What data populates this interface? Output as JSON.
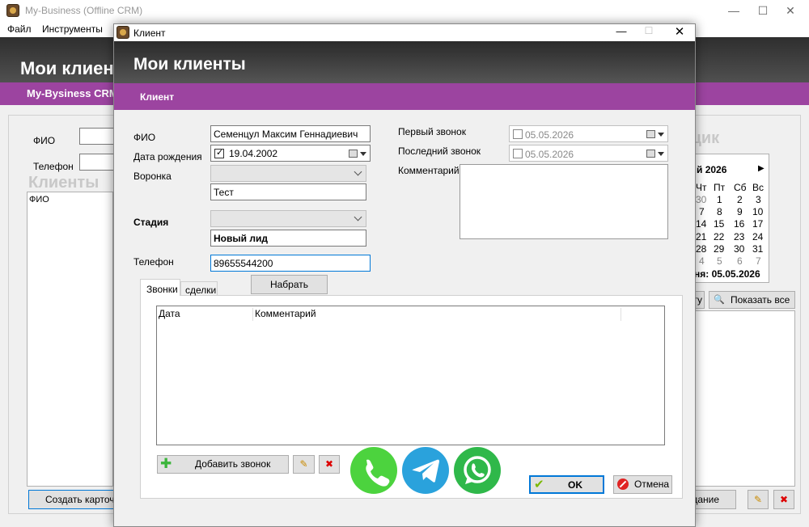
{
  "main_window": {
    "title": "My-Business (Offline CRM)",
    "menu": [
      "Файл",
      "Инструменты"
    ],
    "header_title": "Мои клиенты",
    "subtitle": "My-Bysiness CRM",
    "search": {
      "fio_label": "ФИО",
      "phone_label": "Телефон"
    },
    "clients_heading": "Клиенты",
    "clients_list_header": "ФИО",
    "scheduler_heading": "щик",
    "calendar": {
      "month": "й 2026",
      "day_headers": [
        "Чт",
        "Пт",
        "Сб",
        "Вс"
      ],
      "rows": [
        [
          "30",
          "1",
          "2",
          "3"
        ],
        [
          "7",
          "8",
          "9",
          "10"
        ],
        [
          "14",
          "15",
          "16",
          "17"
        ],
        [
          "21",
          "22",
          "23",
          "24"
        ],
        [
          "28",
          "29",
          "30",
          "31"
        ],
        [
          "4",
          "5",
          "6",
          "7"
        ]
      ],
      "today": "ня: 05.05.2026"
    },
    "buttons": {
      "left_partial": "гу",
      "show_all": "Показать все",
      "create_card": "Создать карточ",
      "bottom_right_partial": "дание"
    }
  },
  "dialog": {
    "title": "Клиент",
    "header_title": "Мои клиенты",
    "subtitle": "Клиент",
    "fio_label": "ФИО",
    "fio_value": "Семенцул Максим Геннадиевич",
    "birth_label": "Дата рождения",
    "birth_value": "19.04.2002",
    "funnel_label": "Воронка",
    "funnel_value": "Тест",
    "stage_label": "Стадия",
    "stage_value": "Новый лид",
    "phone_label": "Телефон",
    "phone_value": "89655544200",
    "dial_button": "Набрать",
    "first_call_label": "Первый звонок",
    "first_call_value": "05.05.2026",
    "last_call_label": "Последний звонок",
    "last_call_value": "05.05.2026",
    "comment_label": "Комментарий",
    "tabs": [
      "Звонки",
      "сделки"
    ],
    "grid_columns": [
      "Дата",
      "Комментарий"
    ],
    "add_call_button": "Добавить звонок",
    "ok_button": "OK",
    "cancel_button": "Отмена",
    "colors": {
      "purple": "#9c44a0",
      "phone": "#4cd33e",
      "telegram": "#2aa2dc",
      "whatsapp": "#2fb84a"
    }
  }
}
